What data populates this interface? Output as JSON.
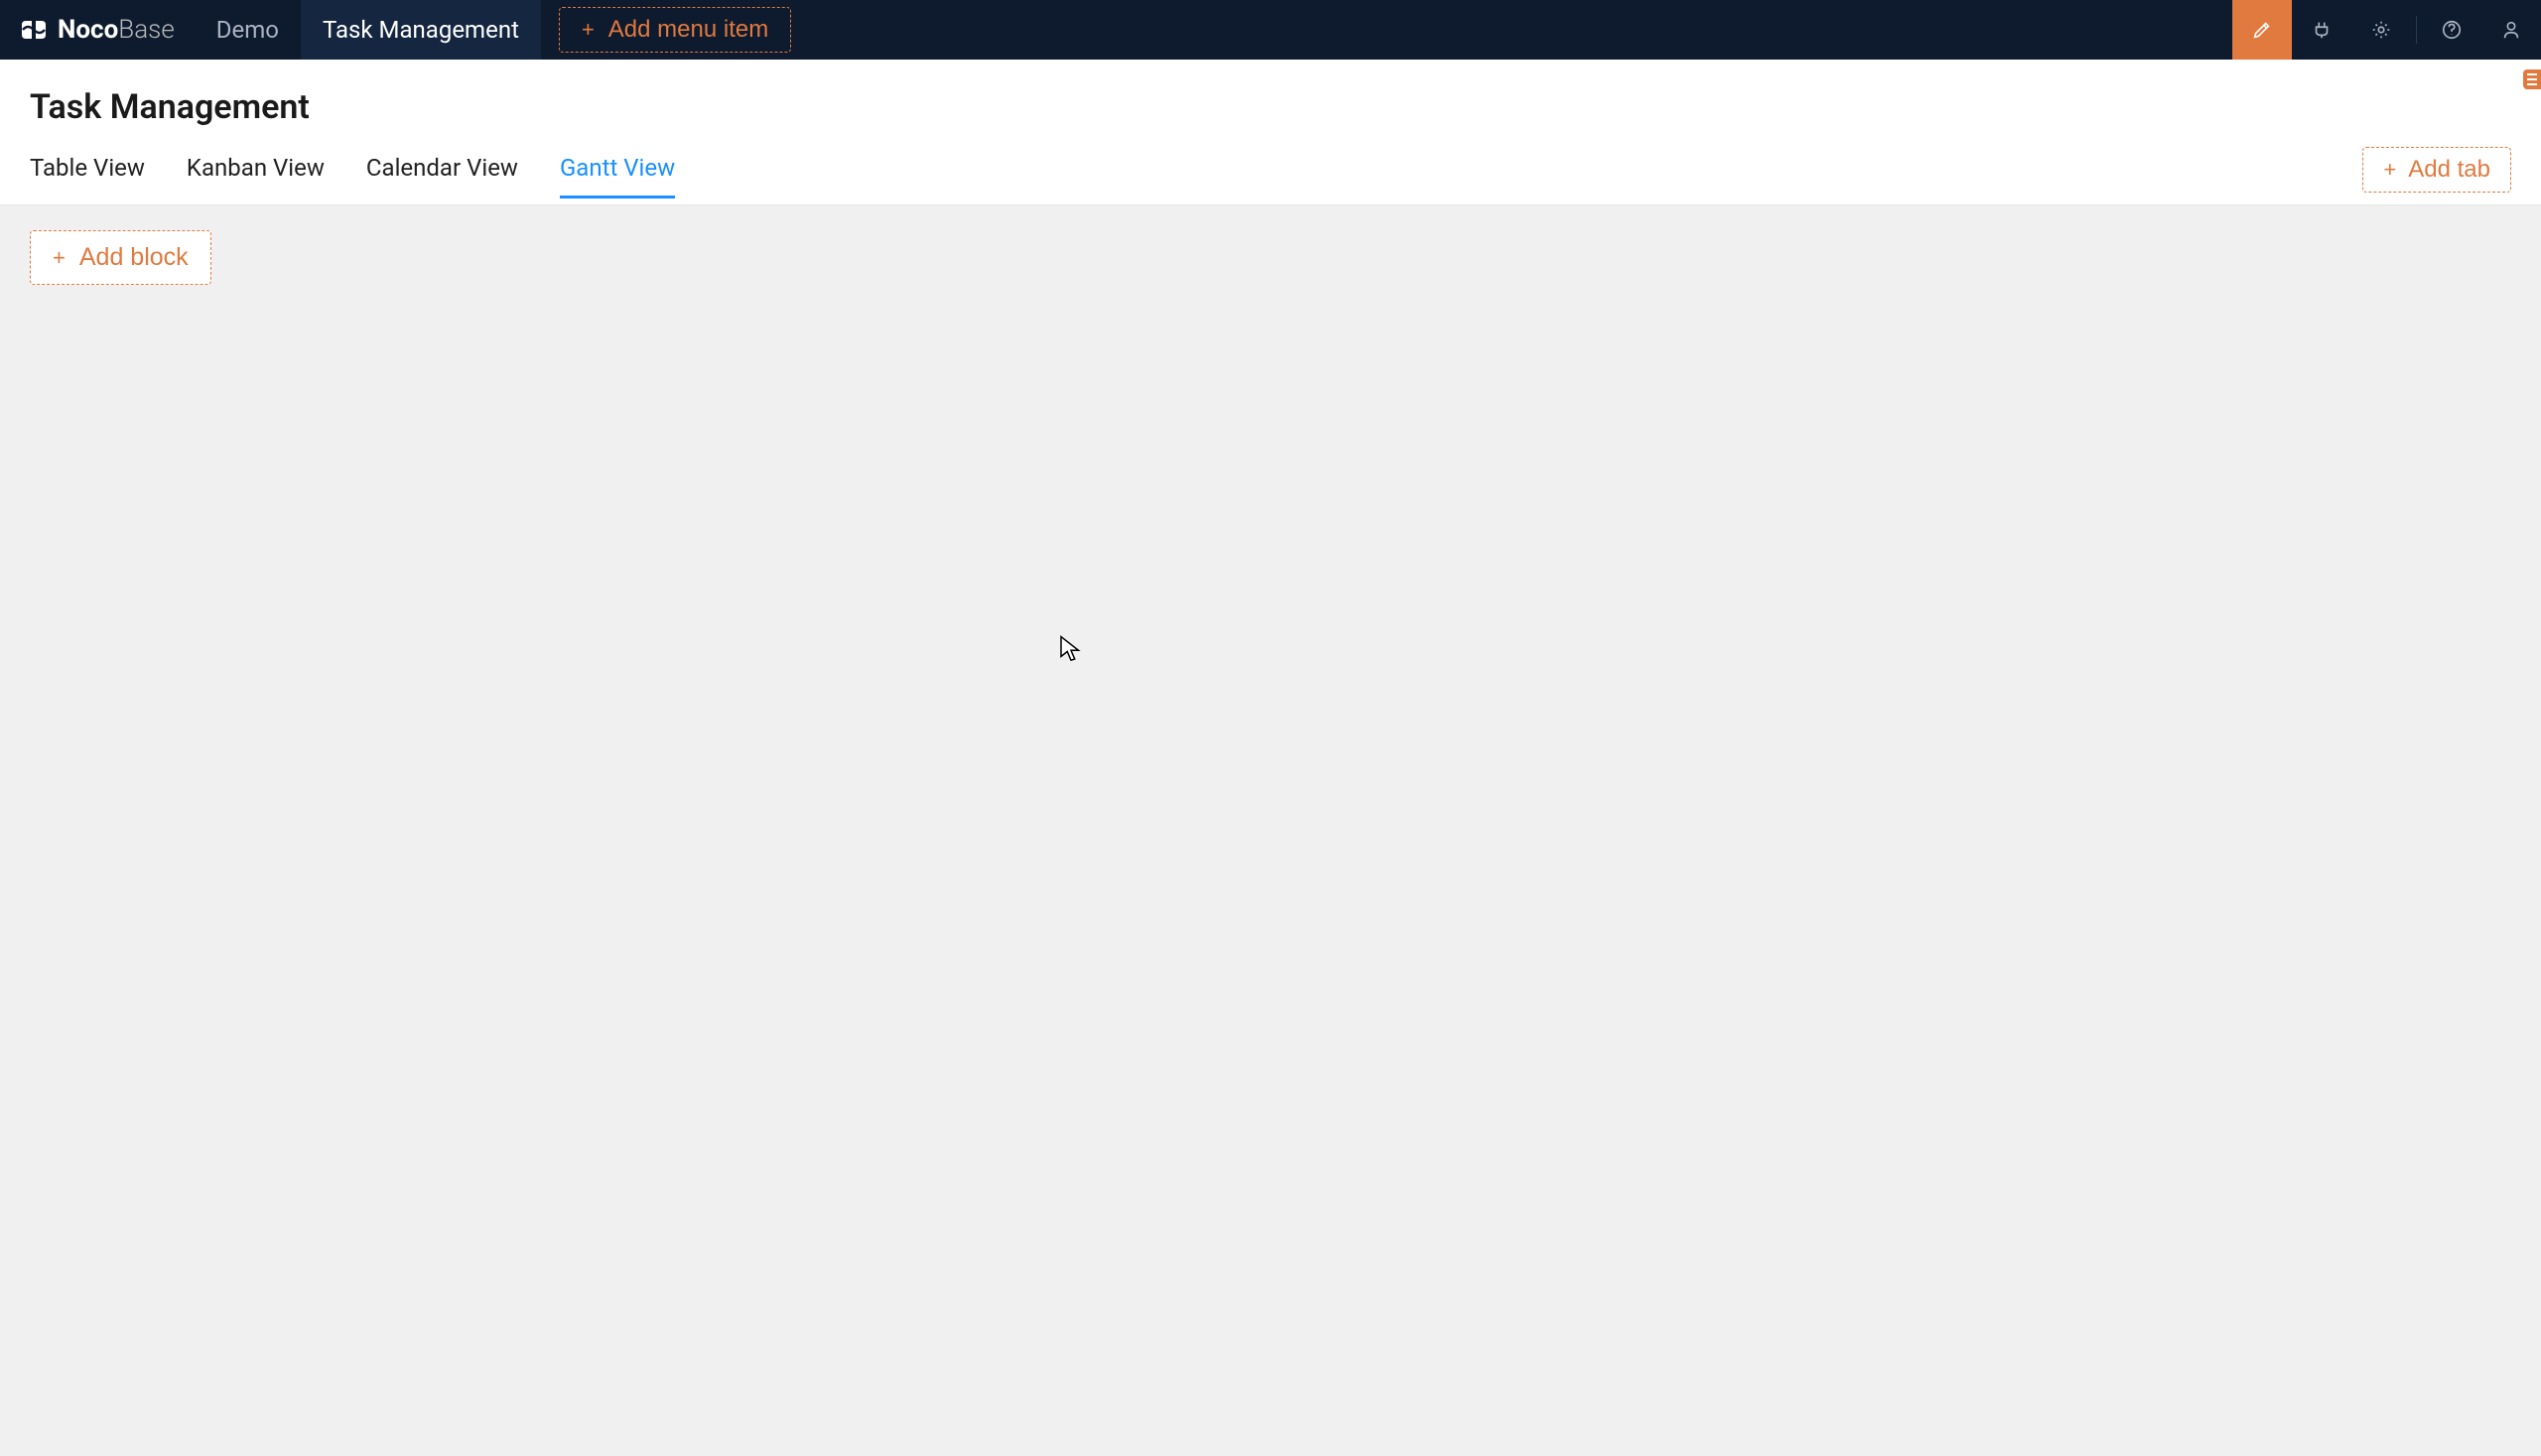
{
  "logo": {
    "text_bold": "Noco",
    "text_light": "Base"
  },
  "nav": {
    "items": [
      {
        "label": "Demo",
        "active": false
      },
      {
        "label": "Task Management",
        "active": true
      }
    ],
    "add_menu_label": "Add menu item"
  },
  "header_icons": {
    "design": "design-icon",
    "plugin": "plugin-icon",
    "settings": "gear-icon",
    "help": "help-icon",
    "user": "user-icon"
  },
  "page": {
    "title": "Task Management",
    "tabs": [
      {
        "label": "Table View",
        "active": false
      },
      {
        "label": "Kanban View",
        "active": false
      },
      {
        "label": "Calendar View",
        "active": false
      },
      {
        "label": "Gantt View",
        "active": true
      }
    ],
    "add_tab_label": "Add tab",
    "add_block_label": "Add block"
  },
  "colors": {
    "accent": "#e07a3f",
    "nav_bg": "#0e1a2e",
    "link": "#1890ff"
  }
}
